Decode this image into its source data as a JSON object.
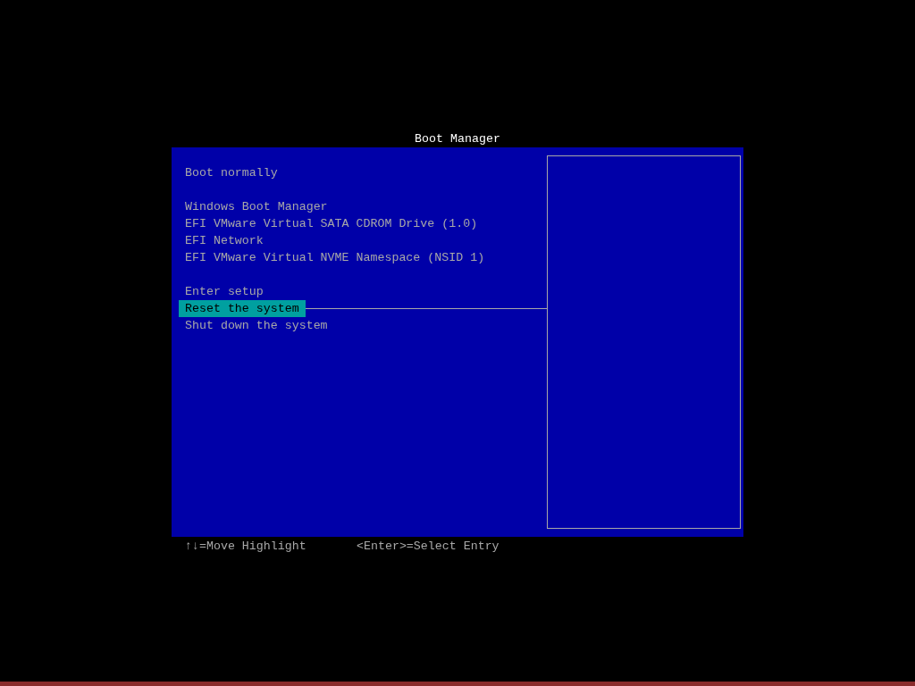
{
  "title": "Boot Manager",
  "groups": [
    {
      "items": [
        {
          "label": "Boot normally",
          "selected": false
        }
      ]
    },
    {
      "items": [
        {
          "label": "Windows Boot Manager",
          "selected": false
        },
        {
          "label": "EFI VMware Virtual SATA CDROM Drive (1.0)",
          "selected": false
        },
        {
          "label": "EFI Network",
          "selected": false
        },
        {
          "label": "EFI VMware Virtual NVME Namespace (NSID 1)",
          "selected": false
        }
      ]
    },
    {
      "items": [
        {
          "label": "Enter setup",
          "selected": false
        },
        {
          "label": "Reset the system",
          "selected": true
        },
        {
          "label": "Shut down the system",
          "selected": false
        }
      ]
    }
  ],
  "footer": [
    "↑↓=Move Highlight",
    "<Enter>=Select Entry"
  ]
}
